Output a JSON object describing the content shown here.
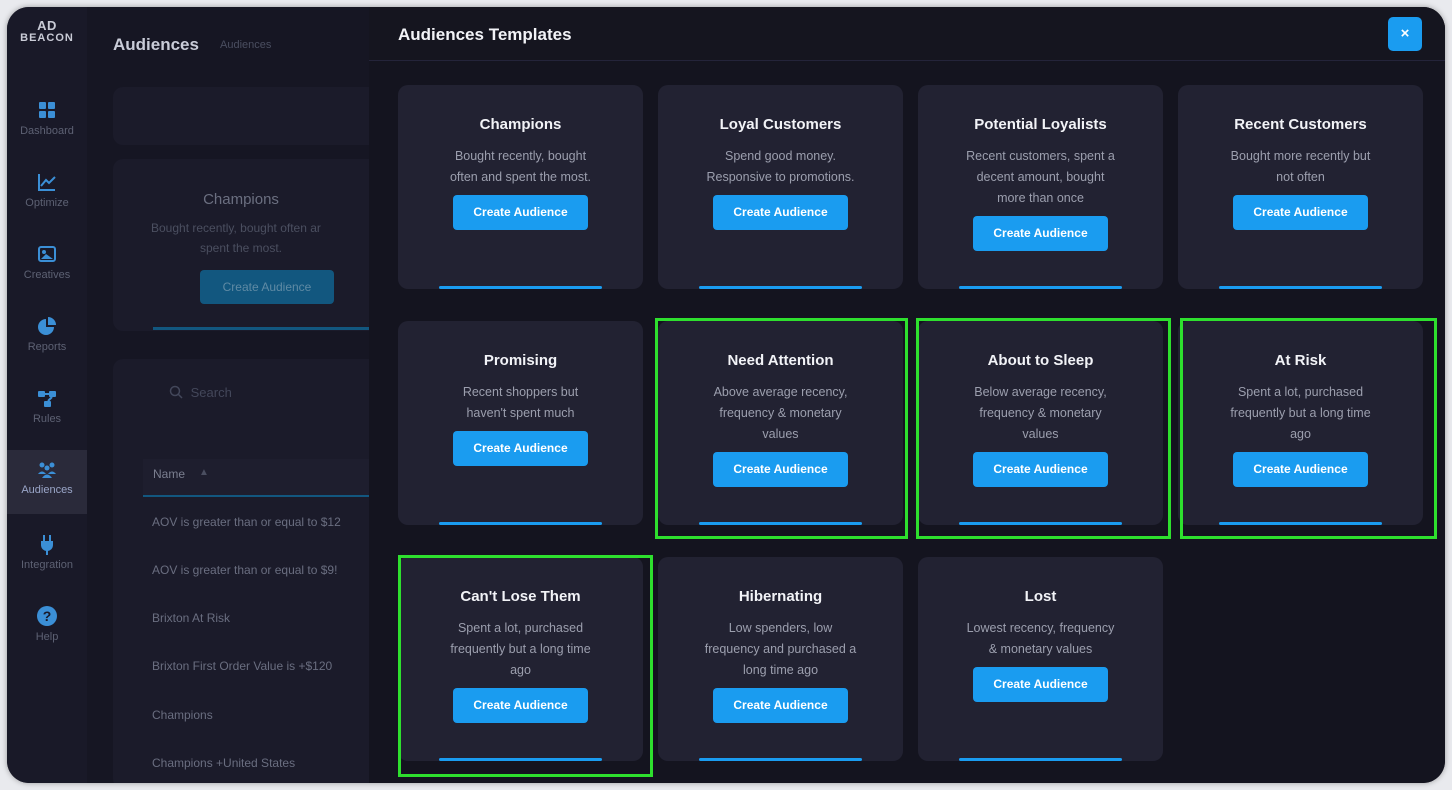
{
  "app": {
    "logo_line1": "AD",
    "logo_line2": "BEACON"
  },
  "sidebar": {
    "items": [
      {
        "label": "Dashboard",
        "icon": "grid-icon"
      },
      {
        "label": "Optimize",
        "icon": "line-chart-icon"
      },
      {
        "label": "Creatives",
        "icon": "image-icon"
      },
      {
        "label": "Reports",
        "icon": "pie-chart-icon"
      },
      {
        "label": "Rules",
        "icon": "rules-icon"
      },
      {
        "label": "Audiences",
        "icon": "users-icon",
        "active": true
      },
      {
        "label": "Integration",
        "icon": "plug-icon"
      },
      {
        "label": "Help",
        "icon": "help-icon"
      }
    ]
  },
  "page": {
    "title": "Audiences",
    "breadcrumb": "Audiences",
    "featured_card": {
      "title": "Champions",
      "desc_line1": "Bought recently, bought often ar",
      "desc_line2": "spent the most.",
      "button": "Create Audience"
    },
    "search_placeholder": "Search",
    "table_header": "Name",
    "rows": [
      "AOV is greater than or equal to $12",
      "AOV is greater than or equal to $9!",
      "Brixton At Risk",
      "Brixton First Order Value is +$120",
      "Champions",
      "Champions +United States"
    ]
  },
  "modal": {
    "title": "Audiences Templates",
    "close_label": "×",
    "highlight_color": "#2ee02e",
    "cards": [
      {
        "title": "Champions",
        "desc": [
          "Bought recently, bought",
          "often and spent the most."
        ],
        "button": "Create Audience"
      },
      {
        "title": "Loyal Customers",
        "desc": [
          "Spend good money.",
          "Responsive to promotions."
        ],
        "button": "Create Audience"
      },
      {
        "title": "Potential Loyalists",
        "desc": [
          "Recent customers, spent a",
          "decent amount, bought",
          "more than once"
        ],
        "button": "Create Audience"
      },
      {
        "title": "Recent Customers",
        "desc": [
          "Bought more recently but",
          "not often"
        ],
        "button": "Create Audience"
      },
      {
        "title": "Promising",
        "desc": [
          "Recent shoppers but",
          "haven't spent much"
        ],
        "button": "Create Audience"
      },
      {
        "title": "Need Attention",
        "desc": [
          "Above average recency,",
          "frequency & monetary",
          "values"
        ],
        "button": "Create Audience",
        "highlighted": true
      },
      {
        "title": "About to Sleep",
        "desc": [
          "Below average recency,",
          "frequency & monetary",
          "values"
        ],
        "button": "Create Audience",
        "highlighted": true
      },
      {
        "title": "At Risk",
        "desc": [
          "Spent a lot, purchased",
          "frequently but a long time",
          "ago"
        ],
        "button": "Create Audience",
        "highlighted": true
      },
      {
        "title": "Can't Lose Them",
        "desc": [
          "Spent a lot, purchased",
          "frequently but a long time",
          "ago"
        ],
        "button": "Create Audience",
        "highlighted": true
      },
      {
        "title": "Hibernating",
        "desc": [
          "Low spenders, low",
          "frequency and purchased a",
          "long time ago"
        ],
        "button": "Create Audience"
      },
      {
        "title": "Lost",
        "desc": [
          "Lowest recency, frequency",
          "& monetary values"
        ],
        "button": "Create Audience"
      }
    ]
  }
}
